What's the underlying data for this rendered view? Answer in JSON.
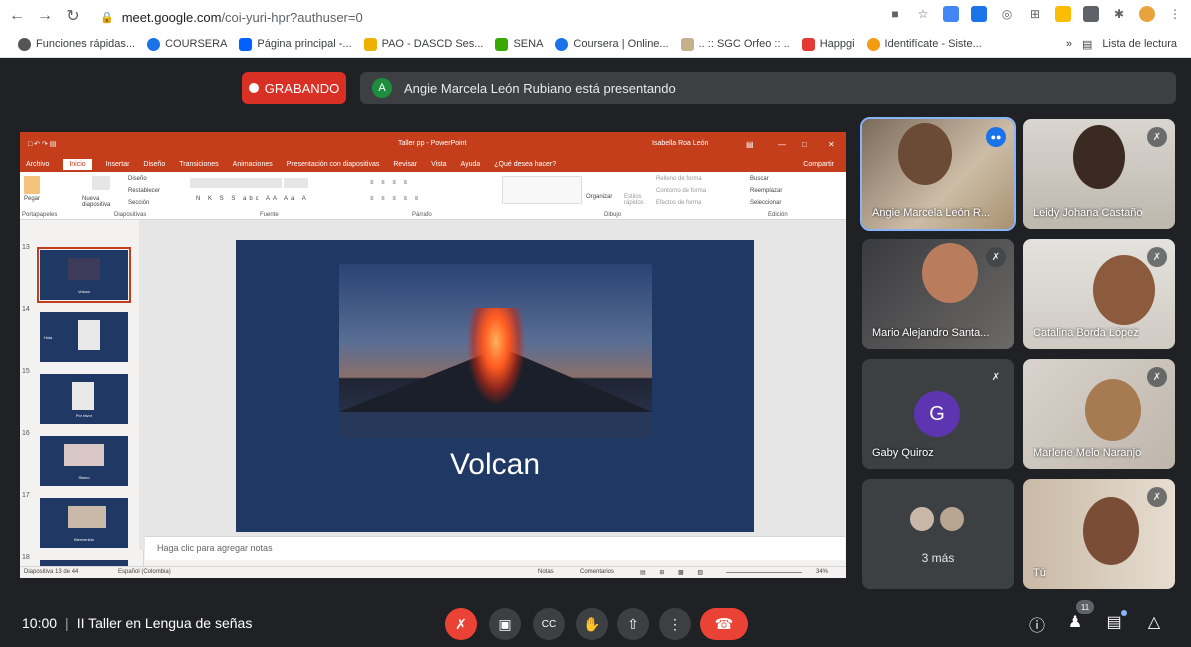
{
  "browser": {
    "url_host": "meet.google.com",
    "url_path": "/coi-yuri-hpr?authuser=0",
    "bookmarks": [
      "Funciones rápidas...",
      "COURSERA",
      "Página principal -...",
      "PAO - DASCD Ses...",
      "SENA",
      "Coursera | Online...",
      ".. :: SGC Orfeo :: ..",
      "Happgi",
      "Identifícate - Siste..."
    ],
    "reading_list": "Lista de lectura",
    "more": "»"
  },
  "banner": {
    "recording": "GRABANDO",
    "presenter_initial": "A",
    "presenting_text": "Angie Marcela León Rubiano está presentando"
  },
  "ppt": {
    "window_title": "Taller pp - PowerPoint",
    "user": "Isabella Roa León",
    "tabs": [
      "Archivo",
      "Inicio",
      "Insertar",
      "Diseño",
      "Transiciones",
      "Animaciones",
      "Presentación con diapositivas",
      "Revisar",
      "Vista",
      "Ayuda",
      "¿Qué desea hacer?"
    ],
    "share": "Compartir",
    "groups": [
      "Portapapeles",
      "Diapositivas",
      "Fuente",
      "Párrafo",
      "Dibujo",
      "Edición"
    ],
    "ribbon_labels": {
      "paste": "Pegar",
      "new_slide": "Nueva diapositiva",
      "layout": "Diseño",
      "reset": "Restablecer",
      "section": "Sección",
      "organize": "Organizar",
      "quick_styles": "Estilos rápidos",
      "shape_fill": "Relleno de forma",
      "shape_outline": "Contorno de forma",
      "shape_effects": "Efectos de forma",
      "find": "Buscar",
      "replace": "Reemplazar",
      "select": "Seleccionar"
    },
    "thumbnails": [
      {
        "num": "13",
        "label": "Volcan"
      },
      {
        "num": "14",
        "label": "Hola"
      },
      {
        "num": "15",
        "label": "Por favor"
      },
      {
        "num": "16",
        "label": "Sismo"
      },
      {
        "num": "17",
        "label": "Bienvenido"
      },
      {
        "num": "18",
        "label": ""
      }
    ],
    "slide_title": "Volcan",
    "notes_placeholder": "Haga clic para agregar notas",
    "status": {
      "slide_info": "Diapositiva 13 de 44",
      "language": "Español (Colombia)",
      "notes": "Notas",
      "comments": "Comentarios",
      "zoom": "34%"
    }
  },
  "participants": [
    {
      "name": "Angie Marcela León R...",
      "muted": false,
      "speaking": true
    },
    {
      "name": "Leidy Johana Castaño",
      "muted": true
    },
    {
      "name": "Mario Alejandro Santa...",
      "muted": true
    },
    {
      "name": "Catalina Borda López",
      "muted": true
    },
    {
      "name": "Gaby Quiroz",
      "muted": true,
      "initial": "G"
    },
    {
      "name": "Marlene Melo Naranjo",
      "muted": true
    },
    {
      "name": "3 más"
    },
    {
      "name": "Tú",
      "muted": true
    }
  ],
  "bottom": {
    "time": "10:00",
    "separator": "|",
    "meeting_name": "II Taller en Lengua de señas",
    "people_count": "11"
  },
  "colors": {
    "meet_bg": "#202124",
    "tile_bg": "#3c4043",
    "recording_red": "#d93025",
    "ppt_orange": "#c43e1c",
    "slide_blue": "#1f3864",
    "avatar_purple": "#5e35b1",
    "active_speaker": "#8ab4f8"
  }
}
